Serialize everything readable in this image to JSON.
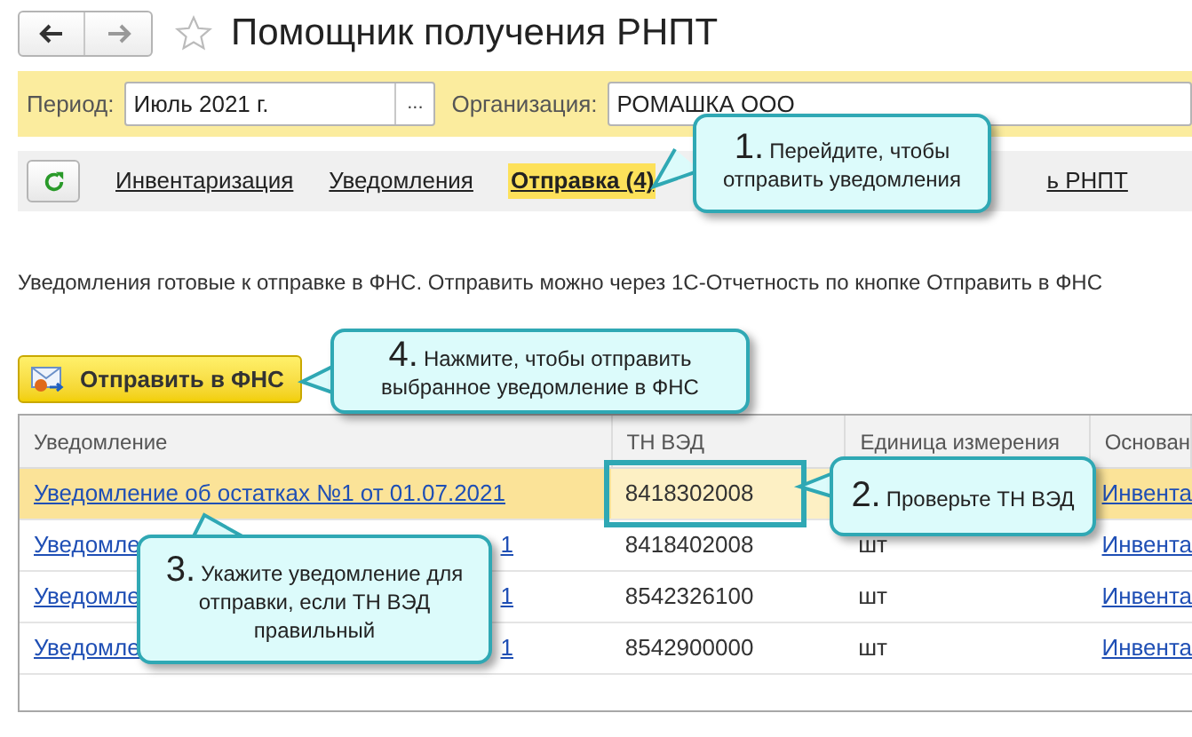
{
  "window": {
    "title": "Помощник получения РНПТ"
  },
  "filters": [
    {
      "label": "Период:",
      "value": "Июль 2021 г.",
      "picker_label": "..."
    },
    {
      "label": "Организация:",
      "value": "РОМАШКА ООО"
    }
  ],
  "tabs": [
    {
      "label": "Инвентаризация",
      "selected": false
    },
    {
      "label": "Уведомления",
      "selected": false
    },
    {
      "label": "Отправка (4)",
      "selected": true
    },
    {
      "label": "ь РНПТ",
      "selected": false
    }
  ],
  "info_text": "Уведомления готовые к отправке в ФНС. Отправить можно через 1С-Отчетность по кнопке Отправить в ФНС",
  "send_button": {
    "label": "Отправить в ФНС"
  },
  "table": {
    "columns": [
      "Уведомление",
      "ТН ВЭД",
      "Единица измерения",
      "Основан"
    ],
    "rows": [
      {
        "selected": true,
        "notice": [
          "Уведомление об остатках №1 от 01.07.2021"
        ],
        "code": "8418302008",
        "code_outlined": true,
        "basis": "Инвента"
      },
      {
        "selected": false,
        "notice": [
          "Уведомле",
          "1"
        ],
        "code": "8418402008",
        "code_outlined": false,
        "unit": "шт",
        "basis": "Инвента"
      },
      {
        "selected": false,
        "notice": [
          "Уведомле",
          "1"
        ],
        "code": "8542326100",
        "code_outlined": false,
        "unit": "шт",
        "basis": "Инвента"
      },
      {
        "selected": false,
        "notice": [
          "Уведомле",
          "1"
        ],
        "code": "8542900000",
        "code_outlined": false,
        "unit": "шт",
        "basis": "Инвента"
      }
    ]
  },
  "callouts": [
    {
      "number": "1.",
      "text": "Перейдите, чтобы отправить уведомления"
    },
    {
      "number": "2.",
      "text": "Проверьте ТН ВЭД"
    },
    {
      "number": "3.",
      "text": "Укажите уведомление для отправки, если ТН ВЭД правильный"
    },
    {
      "number": "4.",
      "text": "Нажмите, чтобы отправить выбранное уведомление в ФНС"
    }
  ]
}
